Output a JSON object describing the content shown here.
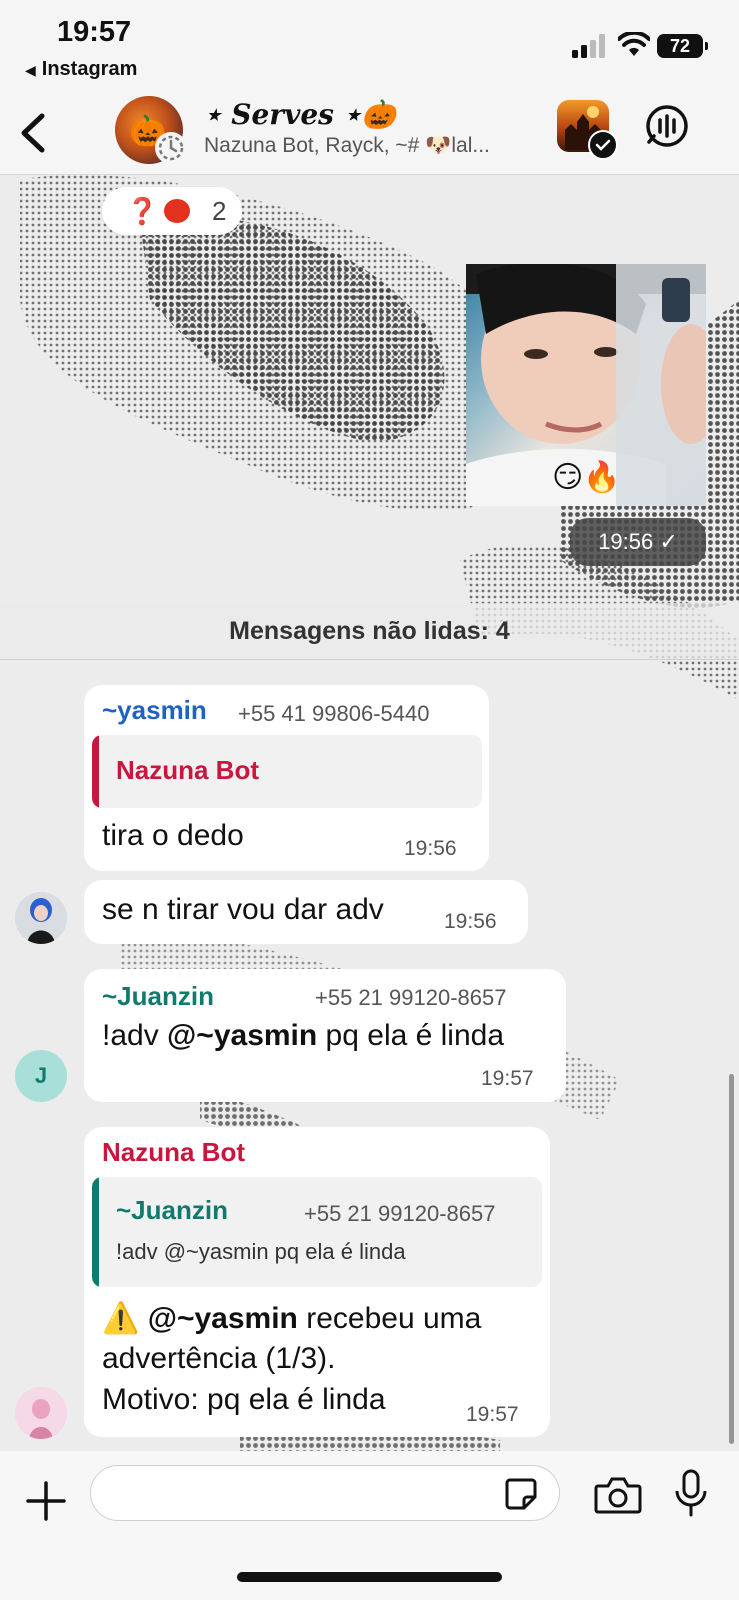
{
  "status_bar": {
    "time": "19:57",
    "back_app": "Instagram",
    "battery": "72"
  },
  "header": {
    "title": "⋆ Serves ⋆🎃",
    "subtitle": "Nazuna Bot, Rayck, ~# 🐶lal..."
  },
  "reaction": {
    "question": "❓",
    "count": "2"
  },
  "sent_photo": {
    "emoji": "😏🔥",
    "time": "19:56"
  },
  "unread_divider": "Mensagens não lidas: 4",
  "messages": [
    {
      "sender": "~yasmin",
      "phone": "+55 41 99806-5440",
      "quote_sender": "Nazuna Bot",
      "text": "tira o dedo",
      "time": "19:56"
    },
    {
      "text": "se n tirar vou dar adv",
      "time": "19:56"
    },
    {
      "sender": "~Juanzin",
      "phone": "+55 21 99120-8657",
      "text_plain_1": "!adv ",
      "mention": "@~yasmin",
      "text_plain_2": " pq ela é linda",
      "time": "19:57",
      "avatar_letter": "J"
    },
    {
      "sender": "Nazuna Bot",
      "quote_sender": "~Juanzin",
      "quote_phone": "+55 21 99120-8657",
      "quote_text": "!adv @~yasmin pq ela é linda",
      "line1_icon": "⚠️",
      "line1_mention": "@~yasmin",
      "line1_rest": " recebeu uma",
      "line2": "advertência (1/3).",
      "line3": "Motivo: pq ela é linda",
      "time": "19:57"
    }
  ],
  "colors": {
    "yasmin": "#1f62c4",
    "juanzin": "#127a6c",
    "nazuna": "#c8163e",
    "juanzin_avatar_bg": "#a8e0d9"
  },
  "icons": {
    "back": "chevron-left-icon",
    "call": "voice-call-icon",
    "plus": "plus-icon",
    "sticker": "sticker-icon",
    "camera": "camera-icon",
    "mic": "microphone-icon"
  }
}
